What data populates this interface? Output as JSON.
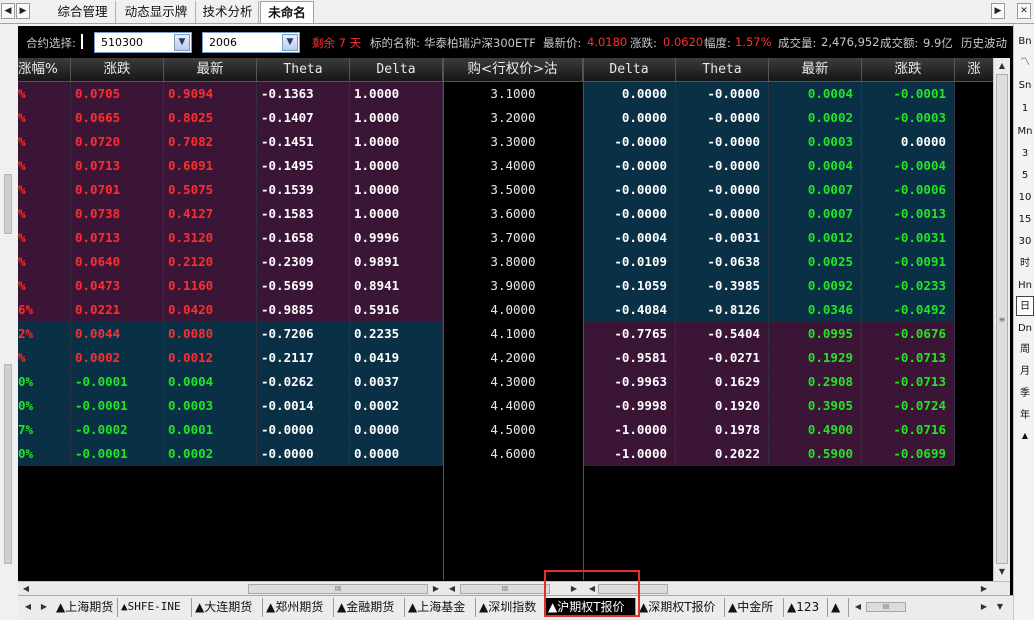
{
  "top_tabs": [
    {
      "label": "综合管理"
    },
    {
      "label": "动态显示牌"
    },
    {
      "label": "技术分析"
    },
    {
      "label": "未命名"
    }
  ],
  "right_toolbar": [
    {
      "label": "Bn"
    },
    {
      "label": "〽"
    },
    {
      "label": "Sn"
    },
    {
      "label": "1"
    },
    {
      "label": "Mn"
    },
    {
      "label": "3"
    },
    {
      "label": "5"
    },
    {
      "label": "10"
    },
    {
      "label": "15"
    },
    {
      "label": "30"
    },
    {
      "label": "时"
    },
    {
      "label": "Hn"
    },
    {
      "label": "日"
    },
    {
      "label": "Dn"
    },
    {
      "label": "周"
    },
    {
      "label": "月"
    },
    {
      "label": "季"
    },
    {
      "label": "年"
    }
  ],
  "info": {
    "contract_label": "合约选择:",
    "contract_value": "510300",
    "month_value": "2006",
    "remaining": "剩余 7 天",
    "underlying_label": "标的名称:",
    "underlying_name": "华泰柏瑞沪深300ETF",
    "last_label": "最新价:",
    "last_value": "4.0180",
    "change_label": "涨跌:",
    "change_value": "0.0620",
    "amp_label": "幅度:",
    "amp_value": "1.57%",
    "volume_label": "成交量:",
    "volume_value": "2,476,952",
    "amount_label": "成交额:",
    "amount_value": "9.9亿",
    "hist_label": "历史波动"
  },
  "columns": [
    {
      "label": "涨幅%"
    },
    {
      "label": "涨跌"
    },
    {
      "label": "最新"
    },
    {
      "label": "Theta"
    },
    {
      "label": "Delta"
    },
    {
      "label": "购<行权价>沽"
    },
    {
      "label": "Delta"
    },
    {
      "label": "Theta"
    },
    {
      "label": "最新"
    },
    {
      "label": "涨跌"
    },
    {
      "label": "涨"
    }
  ],
  "rows": [
    {
      "pct": "%",
      "call_chg": "0.0705",
      "call_last": "0.9094",
      "call_theta": "-0.1363",
      "call_delta": "1.0000",
      "strike": "3.1000",
      "put_delta": "0.0000",
      "put_theta": "-0.0000",
      "put_last": "0.0004",
      "put_chg": "-0.0001"
    },
    {
      "pct": "%",
      "call_chg": "0.0665",
      "call_last": "0.8025",
      "call_theta": "-0.1407",
      "call_delta": "1.0000",
      "strike": "3.2000",
      "put_delta": "0.0000",
      "put_theta": "-0.0000",
      "put_last": "0.0002",
      "put_chg": "-0.0003"
    },
    {
      "pct": "%",
      "call_chg": "0.0720",
      "call_last": "0.7082",
      "call_theta": "-0.1451",
      "call_delta": "1.0000",
      "strike": "3.3000",
      "put_delta": "-0.0000",
      "put_theta": "-0.0000",
      "put_last": "0.0003",
      "put_chg": "0.0000"
    },
    {
      "pct": "%",
      "call_chg": "0.0713",
      "call_last": "0.6091",
      "call_theta": "-0.1495",
      "call_delta": "1.0000",
      "strike": "3.4000",
      "put_delta": "-0.0000",
      "put_theta": "-0.0000",
      "put_last": "0.0004",
      "put_chg": "-0.0004"
    },
    {
      "pct": "%",
      "call_chg": "0.0701",
      "call_last": "0.5075",
      "call_theta": "-0.1539",
      "call_delta": "1.0000",
      "strike": "3.5000",
      "put_delta": "-0.0000",
      "put_theta": "-0.0000",
      "put_last": "0.0007",
      "put_chg": "-0.0006"
    },
    {
      "pct": "%",
      "call_chg": "0.0738",
      "call_last": "0.4127",
      "call_theta": "-0.1583",
      "call_delta": "1.0000",
      "strike": "3.6000",
      "put_delta": "-0.0000",
      "put_theta": "-0.0000",
      "put_last": "0.0007",
      "put_chg": "-0.0013"
    },
    {
      "pct": "%",
      "call_chg": "0.0713",
      "call_last": "0.3120",
      "call_theta": "-0.1658",
      "call_delta": "0.9996",
      "strike": "3.7000",
      "put_delta": "-0.0004",
      "put_theta": "-0.0031",
      "put_last": "0.0012",
      "put_chg": "-0.0031"
    },
    {
      "pct": "%",
      "call_chg": "0.0640",
      "call_last": "0.2120",
      "call_theta": "-0.2309",
      "call_delta": "0.9891",
      "strike": "3.8000",
      "put_delta": "-0.0109",
      "put_theta": "-0.0638",
      "put_last": "0.0025",
      "put_chg": "-0.0091"
    },
    {
      "pct": "%",
      "call_chg": "0.0473",
      "call_last": "0.1160",
      "call_theta": "-0.5699",
      "call_delta": "0.8941",
      "strike": "3.9000",
      "put_delta": "-0.1059",
      "put_theta": "-0.3985",
      "put_last": "0.0092",
      "put_chg": "-0.0233"
    },
    {
      "pct": "6%",
      "call_chg": "0.0221",
      "call_last": "0.0420",
      "call_theta": "-0.9885",
      "call_delta": "0.5916",
      "strike": "4.0000",
      "put_delta": "-0.4084",
      "put_theta": "-0.8126",
      "put_last": "0.0346",
      "put_chg": "-0.0492"
    },
    {
      "pct": "2%",
      "call_chg": "0.0044",
      "call_last": "0.0080",
      "call_theta": "-0.7206",
      "call_delta": "0.2235",
      "strike": "4.1000",
      "put_delta": "-0.7765",
      "put_theta": "-0.5404",
      "put_last": "0.0995",
      "put_chg": "-0.0676"
    },
    {
      "pct": "%",
      "call_chg": "0.0002",
      "call_last": "0.0012",
      "call_theta": "-0.2117",
      "call_delta": "0.0419",
      "strike": "4.2000",
      "put_delta": "-0.9581",
      "put_theta": "-0.0271",
      "put_last": "0.1929",
      "put_chg": "-0.0713"
    },
    {
      "pct": "0%",
      "call_chg": "-0.0001",
      "call_last": "0.0004",
      "call_theta": "-0.0262",
      "call_delta": "0.0037",
      "strike": "4.3000",
      "put_delta": "-0.9963",
      "put_theta": "0.1629",
      "put_last": "0.2908",
      "put_chg": "-0.0713"
    },
    {
      "pct": "0%",
      "call_chg": "-0.0001",
      "call_last": "0.0003",
      "call_theta": "-0.0014",
      "call_delta": "0.0002",
      "strike": "4.4000",
      "put_delta": "-0.9998",
      "put_theta": "0.1920",
      "put_last": "0.3905",
      "put_chg": "-0.0724"
    },
    {
      "pct": "7%",
      "call_chg": "-0.0002",
      "call_last": "0.0001",
      "call_theta": "-0.0000",
      "call_delta": "0.0000",
      "strike": "4.5000",
      "put_delta": "-1.0000",
      "put_theta": "0.1978",
      "put_last": "0.4900",
      "put_chg": "-0.0716"
    },
    {
      "pct": "0%",
      "call_chg": "-0.0001",
      "call_last": "0.0002",
      "call_theta": "-0.0000",
      "call_delta": "0.0000",
      "strike": "4.6000",
      "put_delta": "-1.0000",
      "put_theta": "0.2022",
      "put_last": "0.5900",
      "put_chg": "-0.0699"
    }
  ],
  "scroll_thumb_label": "III",
  "market_tabs": [
    {
      "label": "▲上海期货"
    },
    {
      "label": "▲SHFE-INE"
    },
    {
      "label": "▲大连期货"
    },
    {
      "label": "▲郑州期货"
    },
    {
      "label": "▲金融期货"
    },
    {
      "label": "▲上海基金"
    },
    {
      "label": "▲深圳指数"
    },
    {
      "label": "▲沪期权T报价"
    },
    {
      "label": "▲深期权T报价"
    },
    {
      "label": "▲中金所"
    },
    {
      "label": "▲123"
    },
    {
      "label": "▲"
    }
  ],
  "active_market_tab": "▲沪期权T报价",
  "colors": {
    "call_row_bg": "#3a1535",
    "put_row_bg": "#093045",
    "up_red": "#ff2e2e",
    "down_green": "#22e622",
    "neutral": "#ffffff",
    "highlight": "#e0302a"
  }
}
